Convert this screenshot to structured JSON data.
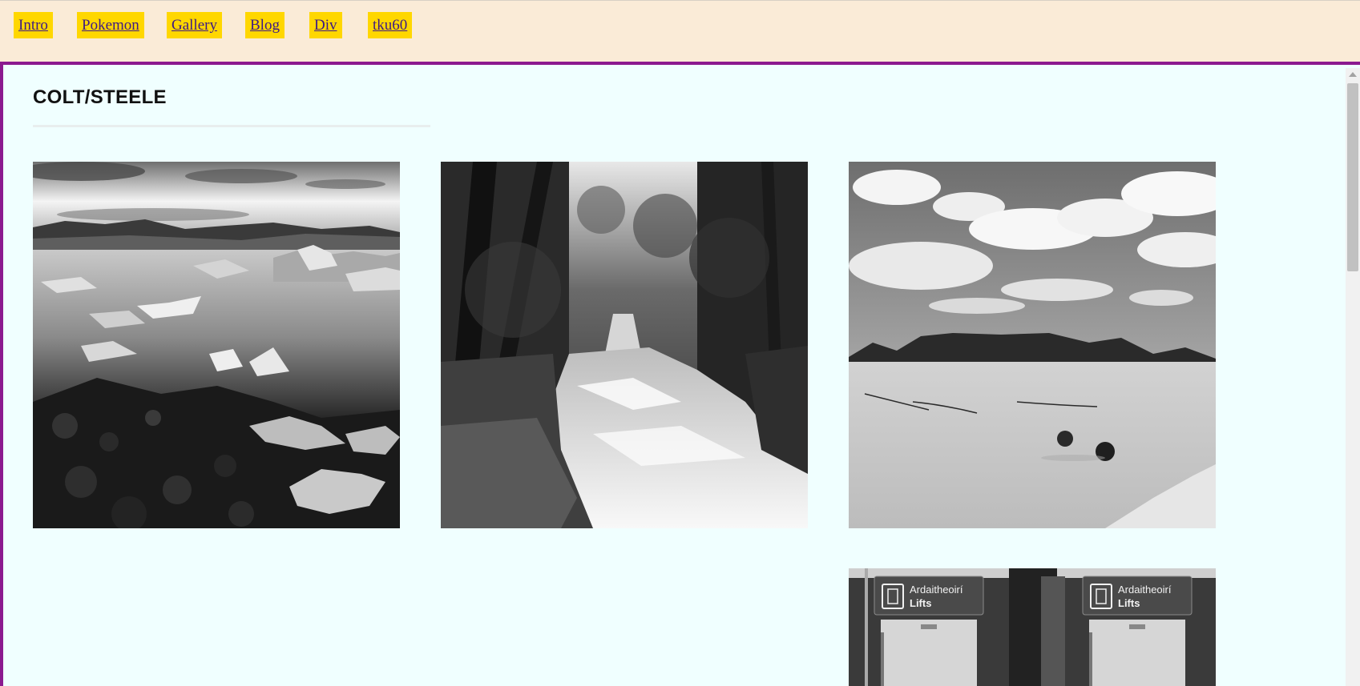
{
  "nav": {
    "links": [
      "Intro",
      "Pokemon",
      "Gallery",
      "Blog",
      "Div",
      "tku60"
    ]
  },
  "page": {
    "brand": "COLT/STEELE"
  },
  "gallery": {
    "photos": [
      {
        "subject": "glacier-lagoon-icebergs"
      },
      {
        "subject": "forest-waterfall"
      },
      {
        "subject": "desert-dunes-mountains"
      },
      {
        "subject": "lifts-signage-station",
        "signs": [
          "Ardaitheoirí",
          "Lifts"
        ]
      }
    ]
  },
  "colors": {
    "topbar_bg": "#faebd7",
    "nav_link_bg": "#ffd700",
    "nav_link_text": "#3d1a86",
    "frame_border": "#8b1a8f",
    "content_bg": "#f0ffff"
  }
}
